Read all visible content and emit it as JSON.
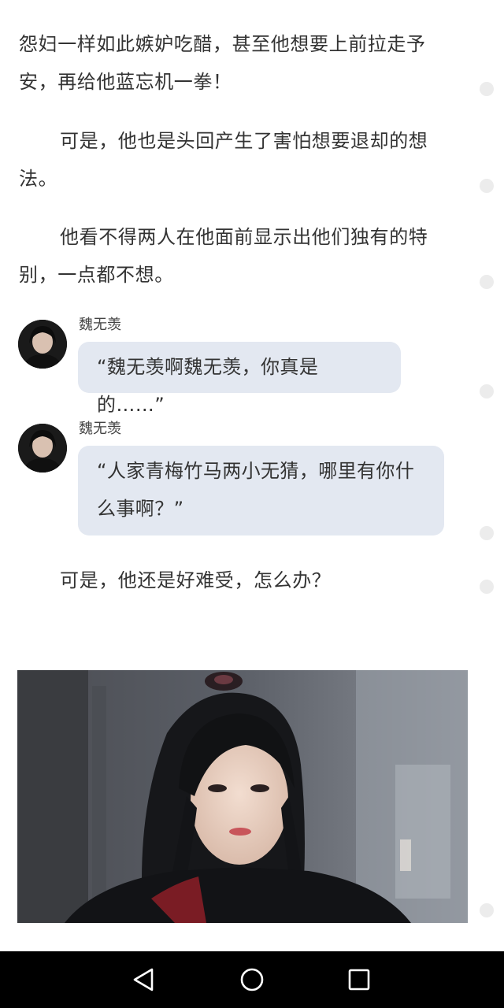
{
  "article": {
    "p1": "怨妇一样如此嫉妒吃醋，甚至他想要上前拉走予安，再给他蓝忘机一拳！",
    "p2": "可是，他也是头回产生了害怕想要退却的想法。",
    "p3": "他看不得两人在他面前显示出他们独有的特别，一点都不想。",
    "p4": "可是，他还是好难受，怎么办？"
  },
  "chat": [
    {
      "speaker": "魏无羡",
      "text": "“魏无羡啊魏无羡，你真是的……”"
    },
    {
      "speaker": "魏无羡",
      "text": "“人家青梅竹马两小无猜，哪里有你什么事啊？”"
    }
  ],
  "icons": {
    "back": "back-triangle-icon",
    "home": "home-circle-icon",
    "recents": "recents-square-icon",
    "comment": "comment-dot-icon"
  },
  "colors": {
    "bubble": "#e3e8f1",
    "text": "#333333",
    "navbar": "#000000"
  }
}
